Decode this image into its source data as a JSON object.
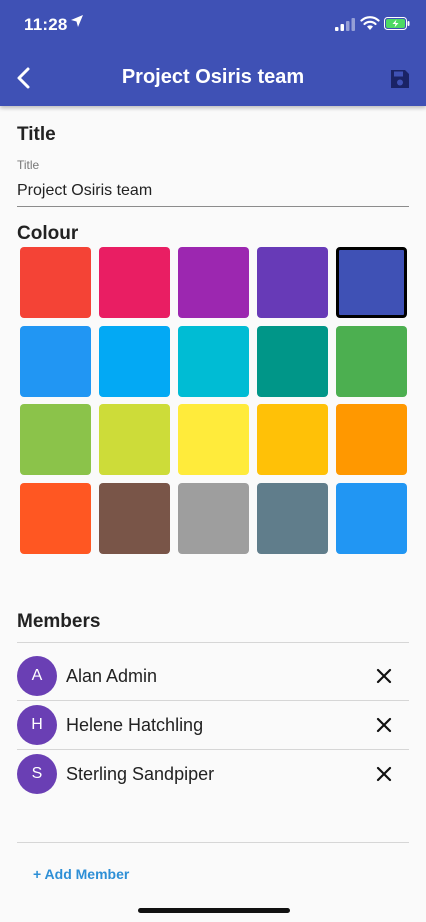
{
  "status_bar": {
    "time": "11:28"
  },
  "appbar": {
    "title": "Project Osiris team",
    "back_icon": "back-arrow-icon",
    "save_icon": "save-floppy-icon",
    "color": "#3f51b5"
  },
  "title_section": {
    "heading": "Title",
    "field_label": "Title",
    "field_value": "Project Osiris team"
  },
  "colour_section": {
    "heading": "Colour",
    "selected_index": 4,
    "swatches": [
      "#f44336",
      "#e91e63",
      "#9c27b0",
      "#673ab7",
      "#3f51b5",
      "#2196f3",
      "#03a9f4",
      "#00bcd4",
      "#009688",
      "#4caf50",
      "#8bc34a",
      "#cddc39",
      "#ffeb3b",
      "#ffc107",
      "#ff9800",
      "#ff5722",
      "#795548",
      "#9e9e9e",
      "#607d8b",
      "#2196f3"
    ]
  },
  "members_section": {
    "heading": "Members",
    "avatar_color": "#6a3fb4",
    "members": [
      {
        "initial": "A",
        "name": "Alan Admin"
      },
      {
        "initial": "H",
        "name": "Helene Hatchling"
      },
      {
        "initial": "S",
        "name": "Sterling Sandpiper"
      }
    ],
    "add_label": "+ Add Member"
  }
}
